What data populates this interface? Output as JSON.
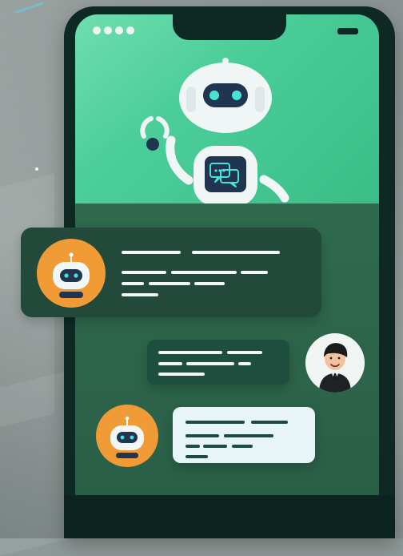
{
  "scene": {
    "name": "chatbot-phone-illustration"
  },
  "colors": {
    "background": "#8e9896",
    "phone_frame": "#0e2924",
    "screen_top": "#56d7a2",
    "screen_bottom": "#2d5f48",
    "bot_avatar": "#f19b37",
    "user_bubble": "#1e4e3d",
    "bot_bubble_dark": "#23493a",
    "bot_bubble_light": "#e8f5f8",
    "robot_eye": "#49e3d6"
  },
  "icons": {
    "robot": "robot-illustration",
    "chat": "chat-bubble-icon",
    "bot_avatar": "robot-head-icon",
    "user_avatar": "person-avatar-icon"
  },
  "messages": [
    {
      "role": "bot",
      "style": "dark"
    },
    {
      "role": "user",
      "style": "dark"
    },
    {
      "role": "bot",
      "style": "light"
    }
  ]
}
